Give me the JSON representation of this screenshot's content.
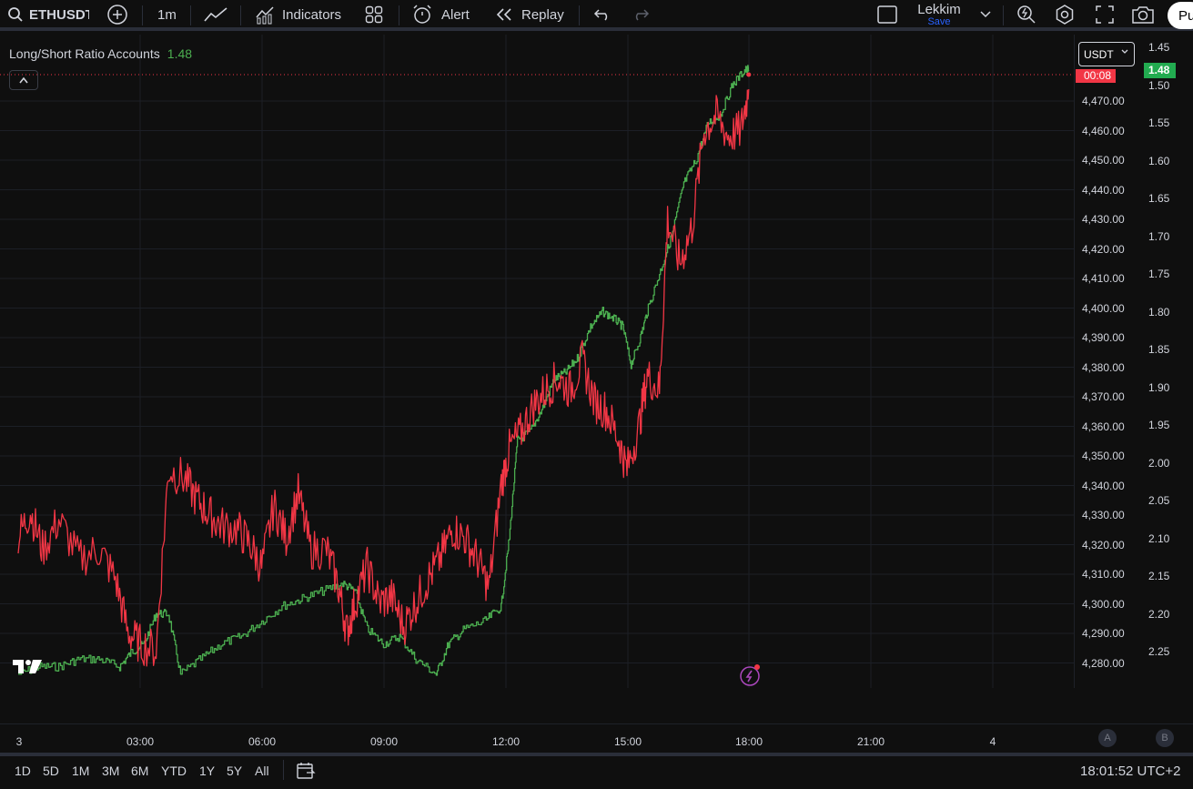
{
  "toolbar": {
    "symbol": "ETHUSDT",
    "interval": "1m",
    "indicators_label": "Indicators",
    "alert_label": "Alert",
    "replay_label": "Replay",
    "layout_name": "Lekkim",
    "save_label": "Save",
    "publish_label": "Pu"
  },
  "legend": {
    "name": "Long/Short Ratio Accounts",
    "value": "1.48"
  },
  "price_scale": {
    "currency": "USDT",
    "countdown": "00:08",
    "current_ratio": "1.48",
    "left_labels": [
      "4,470.00",
      "4,460.00",
      "4,450.00",
      "4,440.00",
      "4,430.00",
      "4,420.00",
      "4,410.00",
      "4,400.00",
      "4,390.00",
      "4,380.00",
      "4,370.00",
      "4,360.00",
      "4,350.00",
      "4,340.00",
      "4,330.00",
      "4,320.00",
      "4,310.00",
      "4,300.00",
      "4,290.00",
      "4,280.00"
    ],
    "right_labels": [
      "1.45",
      "1.50",
      "1.55",
      "1.60",
      "1.65",
      "1.70",
      "1.75",
      "1.80",
      "1.85",
      "1.90",
      "1.95",
      "2.00",
      "2.05",
      "2.10",
      "2.15",
      "2.20",
      "2.25"
    ]
  },
  "time_axis": {
    "labels": [
      "3",
      "03:00",
      "06:00",
      "09:00",
      "12:00",
      "15:00",
      "18:00",
      "21:00",
      "4"
    ],
    "auto_label": "A",
    "log_label": "B"
  },
  "ranges": [
    "1D",
    "5D",
    "1M",
    "3M",
    "6M",
    "YTD",
    "1Y",
    "5Y",
    "All"
  ],
  "clock": "18:01:52 UTC+2",
  "colors": {
    "price_line": "#f23645",
    "ratio_line": "#4caf50",
    "background": "#0f0f0f"
  },
  "chart_data": {
    "type": "line",
    "x_start": "00:00",
    "x_end": "18:01",
    "series": [
      {
        "name": "ETHUSDT",
        "axis": "left",
        "x_hours": [
          0,
          0.3,
          0.6,
          1.0,
          1.5,
          2.0,
          2.4,
          2.7,
          3.0,
          3.4,
          3.7,
          4.1,
          4.4,
          4.7,
          5.0,
          5.4,
          5.7,
          6.0,
          6.3,
          6.6,
          6.9,
          7.2,
          7.6,
          7.9,
          8.1,
          8.3,
          8.6,
          8.9,
          9.2,
          9.5,
          9.8,
          10.1,
          10.4,
          10.7,
          11.0,
          11.3,
          11.6,
          11.9,
          12.1,
          12.4,
          12.7,
          13.0,
          13.3,
          13.6,
          13.9,
          14.2,
          14.5,
          14.8,
          15.0,
          15.3,
          15.5,
          15.8,
          16.0,
          16.3,
          16.6,
          16.9,
          17.2,
          17.5,
          17.8,
          18.0
        ],
        "values": [
          4322,
          4331,
          4318,
          4328,
          4315,
          4318,
          4308,
          4290,
          4286,
          4284,
          4345,
          4342,
          4335,
          4330,
          4326,
          4325,
          4320,
          4312,
          4333,
          4322,
          4337,
          4318,
          4318,
          4305,
          4290,
          4300,
          4312,
          4300,
          4302,
          4292,
          4300,
          4308,
          4315,
          4325,
          4322,
          4315,
          4305,
          4340,
          4352,
          4358,
          4367,
          4372,
          4376,
          4372,
          4382,
          4368,
          4365,
          4355,
          4345,
          4360,
          4377,
          4372,
          4430,
          4415,
          4427,
          4460,
          4465,
          4458,
          4460,
          4474
        ]
      },
      {
        "name": "Long/Short Ratio Accounts",
        "axis": "right",
        "x_hours": [
          0,
          0.5,
          1.0,
          1.5,
          2.0,
          2.5,
          2.8,
          3.1,
          3.4,
          3.7,
          4.0,
          4.5,
          5.0,
          5.5,
          6.0,
          6.5,
          7.0,
          7.5,
          8.0,
          8.3,
          8.6,
          9.0,
          9.4,
          9.8,
          10.3,
          10.6,
          11.0,
          11.5,
          11.9,
          12.1,
          12.3,
          12.6,
          12.9,
          13.2,
          13.5,
          13.8,
          14.1,
          14.4,
          14.7,
          14.9,
          15.1,
          15.3,
          15.5,
          15.8,
          16.1,
          16.4,
          16.7,
          17.0,
          17.3,
          17.6,
          17.9,
          18.0
        ],
        "values": [
          2.28,
          2.27,
          2.27,
          2.26,
          2.26,
          2.27,
          2.25,
          2.24,
          2.2,
          2.2,
          2.28,
          2.26,
          2.24,
          2.23,
          2.21,
          2.19,
          2.18,
          2.17,
          2.16,
          2.17,
          2.22,
          2.24,
          2.23,
          2.26,
          2.28,
          2.24,
          2.22,
          2.21,
          2.19,
          2.1,
          1.97,
          1.96,
          1.93,
          1.89,
          1.88,
          1.86,
          1.82,
          1.8,
          1.81,
          1.82,
          1.87,
          1.84,
          1.8,
          1.75,
          1.7,
          1.63,
          1.6,
          1.55,
          1.54,
          1.5,
          1.48,
          1.48
        ]
      }
    ],
    "y_left_range": [
      4275,
      4485
    ],
    "y_right_range": [
      1.45,
      2.28
    ],
    "grid": true
  }
}
